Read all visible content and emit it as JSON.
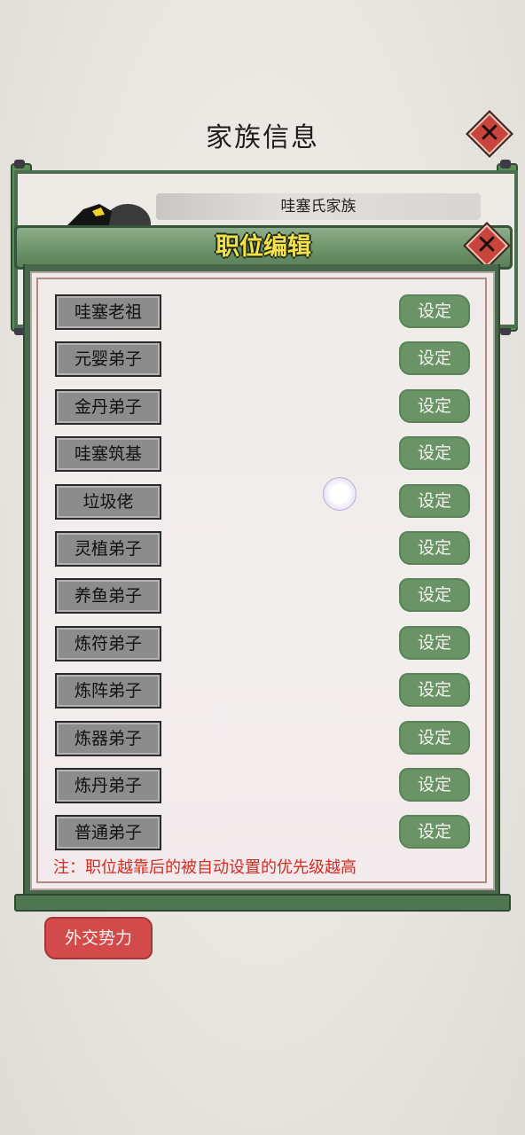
{
  "page": {
    "title": "家族信息"
  },
  "clan": {
    "name": "哇塞氏家族"
  },
  "dialog": {
    "title": "职位编辑",
    "set_label": "设定",
    "roles": [
      "哇塞老祖",
      "元婴弟子",
      "金丹弟子",
      "哇塞筑基",
      "垃圾佬",
      "灵植弟子",
      "养鱼弟子",
      "炼符弟子",
      "炼阵弟子",
      "炼器弟子",
      "炼丹弟子",
      "普通弟子"
    ],
    "note": "注：职位越靠后的被自动设置的优先级越高"
  },
  "footer": {
    "diplomacy_label": "外交势力"
  },
  "icons": {
    "close": "close-icon",
    "avatar": "avatar-icon"
  },
  "colors": {
    "accent_green": "#6a9466",
    "close_red": "#c9443c",
    "note_red": "#d42c22",
    "title_yellow": "#f6e04a"
  }
}
